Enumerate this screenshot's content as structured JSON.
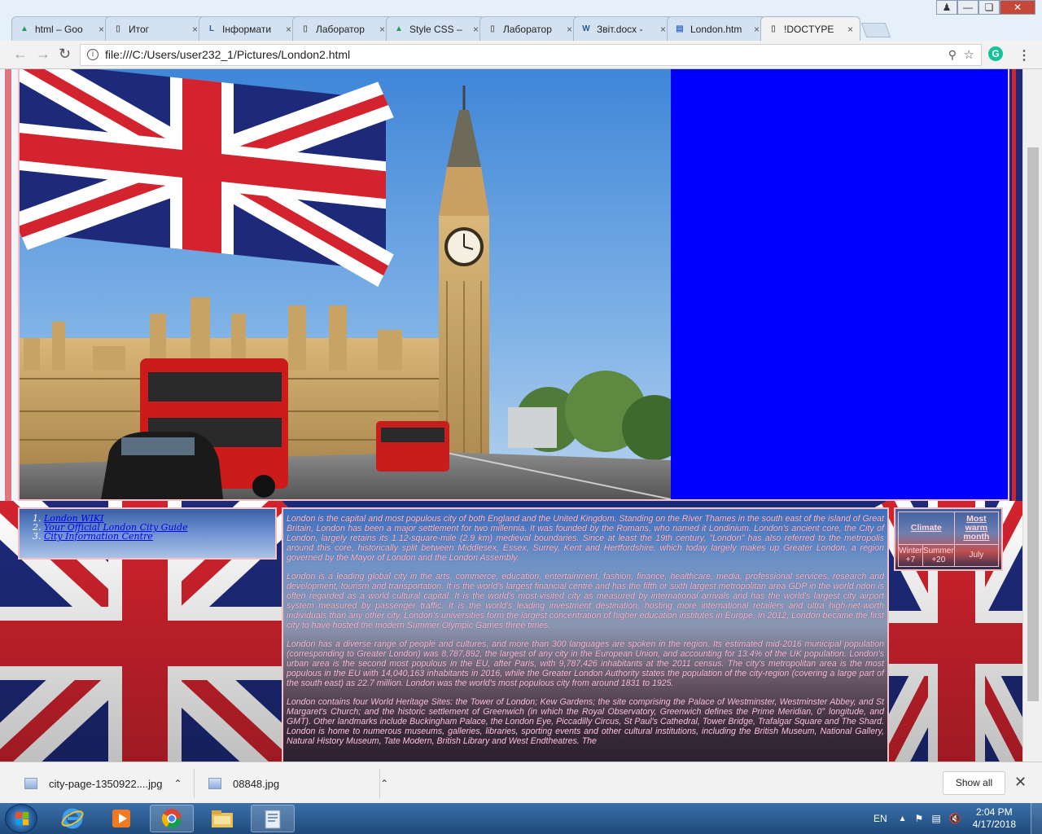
{
  "browser": {
    "tabs": [
      {
        "label": "html – Goo",
        "favicon": "drive-icon",
        "favicon_color": "#1a9e5a"
      },
      {
        "label": "Итог",
        "favicon": "page-icon",
        "favicon_color": "#666666"
      },
      {
        "label": "Інформати",
        "favicon": "lvb-icon",
        "favicon_color": "#2b5bb5"
      },
      {
        "label": "Лаборатор",
        "favicon": "page-icon",
        "favicon_color": "#666666"
      },
      {
        "label": "Style CSS –",
        "favicon": "drive-icon",
        "favicon_color": "#1a9e5a"
      },
      {
        "label": "Лаборатор",
        "favicon": "page-icon",
        "favicon_color": "#666666"
      },
      {
        "label": "Звіт.docx -",
        "favicon": "word-icon",
        "favicon_color": "#2b5797"
      },
      {
        "label": "London.htm",
        "favicon": "doc-icon",
        "favicon_color": "#3b6fc4"
      },
      {
        "label": "!DOCTYPE",
        "favicon": "page-icon",
        "favicon_color": "#666666",
        "active": true
      }
    ],
    "url": "file:///C:/Users/user232_1/Pictures/London2.html"
  },
  "page": {
    "links": [
      {
        "num": "1.",
        "label": "London WIKI"
      },
      {
        "num": "2.",
        "label": "Your Official London City Guide"
      },
      {
        "num": "3.",
        "label": "City Information Centre"
      }
    ],
    "paragraphs": [
      "London is the capital and most populous city of both England and the United Kingdom. Standing on the River Thames in the south east of the island of Great Britain, London has been a major settlement for two millennia. It was founded by the Romans, who named it Londinium. London's ancient core, the City of London, largely retains its 1.12-square-mile (2.9 km) medieval boundaries. Since at least the 19th century, \"London\" has also referred to the metropolis around this core, historically split between Middlesex, Essex, Surrey, Kent and Hertfordshire, which today largely makes up Greater London, a region governed by the Mayor of London and the London Assembly.",
      "London is a leading global city in the arts, commerce, education, entertainment, fashion, finance, healthcare, media, professional services, research and development, tourism and transportation. It is the world's largest financial centre and has the fifth or sixth largest metropolitan area GDP in the world.ndon is often regarded as a world cultural capital. It is the world's most-visited city as measured by international arrivals and has the world's largest city airport system measured by passenger traffic. It is the world's leading investment destination, hosting more international retailers and ultra high-net-worth individuals than any other city. London's universities form the largest concentration of higher education institutes in Europe. In 2012, London became the first city to have hosted the modern Summer Olympic Games three times.",
      "London has a diverse range of people and cultures, and more than 300 languages are spoken in the region. Its estimated mid-2016 municipal population (corresponding to Greater London) was 8,787,892, the largest of any city in the European Union, and accounting for 13.4% of the UK population. London's urban area is the second most populous in the EU, after Paris, with 9,787,426 inhabitants at the 2011 census. The city's metropolitan area is the most populous in the EU with 14,040,163 inhabitants in 2016, while the Greater London Authority states the population of the city-region (covering a large part of the south east) as 22.7 million. London was the world's most populous city from around 1831 to 1925.",
      "London contains four World Heritage Sites: the Tower of London; Kew Gardens; the site comprising the Palace of Westminster, Westminster Abbey, and St Margaret's Church; and the historic settlement of Greenwich (in which the Royal Observatory, Greenwich defines the Prime Meridian, 0° longitude, and GMT). Other landmarks include Buckingham Palace, the London Eye, Piccadilly Circus, St Paul's Cathedral, Tower Bridge, Trafalgar Square and The Shard. London is home to numerous museums, galleries, libraries, sporting events and other cultural institutions, including the British Museum, National Gallery, Natural History Museum, Tate Modern, British Library and West Endtheatres. The"
    ],
    "climate": {
      "header": "Climate",
      "warm_label": "Most warm month",
      "winter": "Winter",
      "winter_value": "+7",
      "summer": "Summer",
      "summer_value": "+20",
      "month": "July"
    }
  },
  "downloads": {
    "items": [
      {
        "name": "city-page-1350922....jpg"
      },
      {
        "name": "08848.jpg"
      }
    ],
    "show_all": "Show all"
  },
  "taskbar": {
    "lang": "EN",
    "time": "2:04 PM",
    "date": "4/17/2018"
  },
  "colors": {
    "hero_panel": "#0000ff",
    "paragraph_text": "#ffc0cb",
    "link": "#0000ee",
    "flag_blue": "#1d2a7a",
    "flag_red": "#d2232e"
  }
}
